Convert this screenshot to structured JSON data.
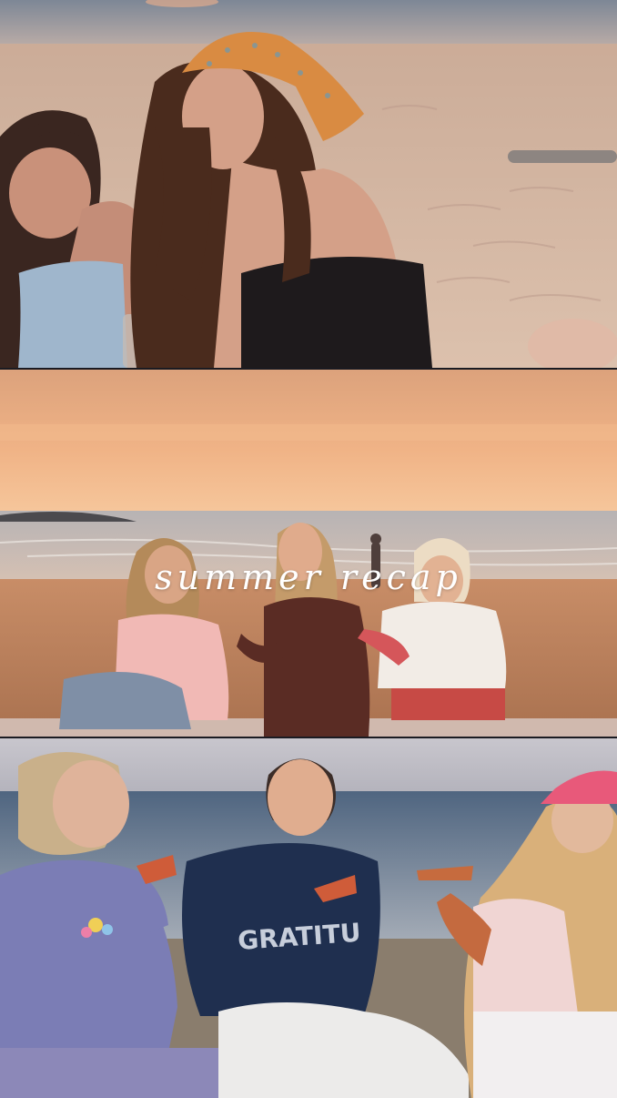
{
  "story": {
    "overlay_text": "summer recap",
    "shirt_text": "GRATITU"
  },
  "panels": [
    {
      "scene": "two-friends-on-sand"
    },
    {
      "scene": "sunset-picnic"
    },
    {
      "scene": "pizza-on-beach"
    }
  ],
  "colors": {
    "sand": "#d9b9a3",
    "sunset_sky": "#eeb184",
    "ocean": "#9c9fae",
    "overlay_text": "#ffffff",
    "navy_sweatshirt": "#1f2f4f",
    "pink_cap": "#e8597a"
  }
}
